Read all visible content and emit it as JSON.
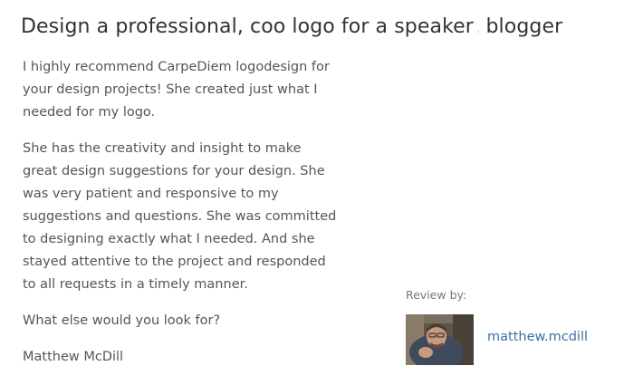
{
  "review": {
    "title_part1": "Design a professional, coo logo for a speaker",
    "title_separator": ",",
    "title_part2": "blogger",
    "paragraphs": [
      "I highly recommend CarpeDiem logodesign for your design projects! She created just what I needed for my logo.",
      "She has the creativity and insight to make great design suggestions for your design. She was very patient and responsive to my suggestions and questions. She was committed to designing exactly what I needed. And she stayed attentive to the project and responded to all requests in a timely manner.",
      "What else would you look for?"
    ],
    "signature": "Matthew McDill"
  },
  "reviewer": {
    "caption": "Review by:",
    "username": "matthew.mcdill",
    "avatar_icon": "user-photo"
  },
  "colors": {
    "link": "#3a6fa6",
    "title": "#333333",
    "body_text": "#555555"
  }
}
